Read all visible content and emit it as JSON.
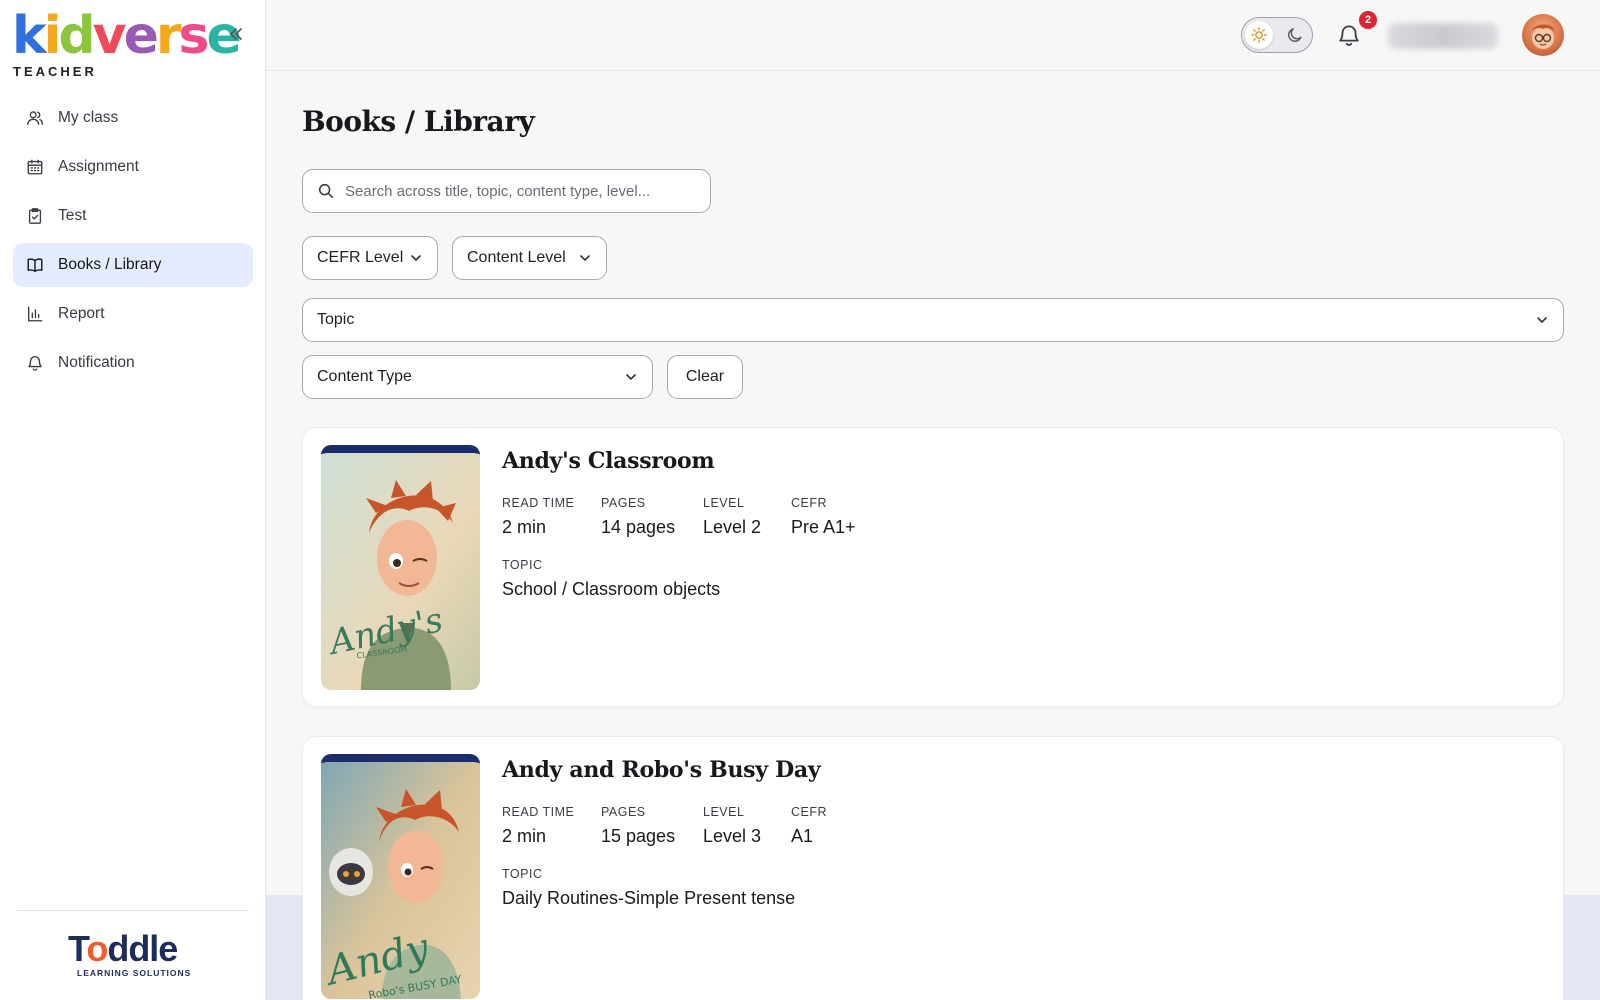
{
  "brand": {
    "logo_text": "kidverse",
    "logo_subtitle": "TEACHER",
    "footer_logo": "Toddle",
    "footer_subtitle": "LEARNING SOLUTIONS"
  },
  "sidebar": {
    "items": [
      {
        "label": "My class",
        "icon": "users-icon",
        "active": false
      },
      {
        "label": "Assignment",
        "icon": "calendar-icon",
        "active": false
      },
      {
        "label": "Test",
        "icon": "clipboard-check-icon",
        "active": false
      },
      {
        "label": "Books / Library",
        "icon": "open-book-icon",
        "active": true
      },
      {
        "label": "Report",
        "icon": "bar-chart-icon",
        "active": false
      },
      {
        "label": "Notification",
        "icon": "bell-icon",
        "active": false
      }
    ]
  },
  "topbar": {
    "notification_count": "2"
  },
  "page": {
    "title": "Books / Library",
    "search_placeholder": "Search across title, topic, content type, level...",
    "filters": {
      "cefr": "CEFR Level",
      "content_level": "Content Level",
      "topic": "Topic",
      "content_type": "Content Type",
      "clear": "Clear"
    }
  },
  "books": [
    {
      "title": "Andy's Classroom",
      "read_time_label": "READ TIME",
      "read_time": "2 min",
      "pages_label": "PAGES",
      "pages": "14 pages",
      "level_label": "LEVEL",
      "level": "Level 2",
      "cefr_label": "CEFR",
      "cefr": "Pre A1+",
      "topic_label": "TOPIC",
      "topic": "School / Classroom objects",
      "cover_text": "Andy's",
      "cover_subtext": "CLASSROOM"
    },
    {
      "title": "Andy and Robo's Busy Day",
      "read_time_label": "READ TIME",
      "read_time": "2 min",
      "pages_label": "PAGES",
      "pages": "15 pages",
      "level_label": "LEVEL",
      "level": "Level 3",
      "cefr_label": "CEFR",
      "cefr": "A1",
      "topic_label": "TOPIC",
      "topic": "Daily Routines-Simple Present tense",
      "cover_text": "Andy",
      "cover_subtext": "Robo's BUSY DAY"
    }
  ]
}
